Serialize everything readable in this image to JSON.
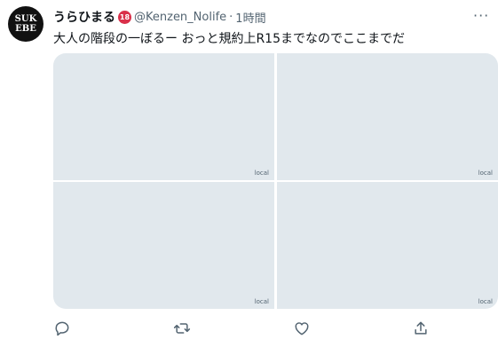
{
  "author": {
    "display_name": "うらひまる",
    "badge": "18",
    "handle": "@Kenzen_Nolife",
    "separator": "·",
    "time": "1時間",
    "avatar_line1": "SUK",
    "avatar_line2": "EBE"
  },
  "tweet": {
    "text": "大人の階段の一ぼるー おっと規約上R15までなのでここまでだ"
  },
  "media": [
    {
      "caption": "local"
    },
    {
      "caption": "local"
    },
    {
      "caption": "local"
    },
    {
      "caption": "local"
    }
  ],
  "icons": {
    "more": "more-horizontal-icon",
    "reply": "reply-icon",
    "retweet": "retweet-icon",
    "like": "like-icon",
    "share": "share-icon"
  },
  "colors": {
    "badge": "#d9304a",
    "muted": "#536471",
    "text": "#0f1419"
  }
}
